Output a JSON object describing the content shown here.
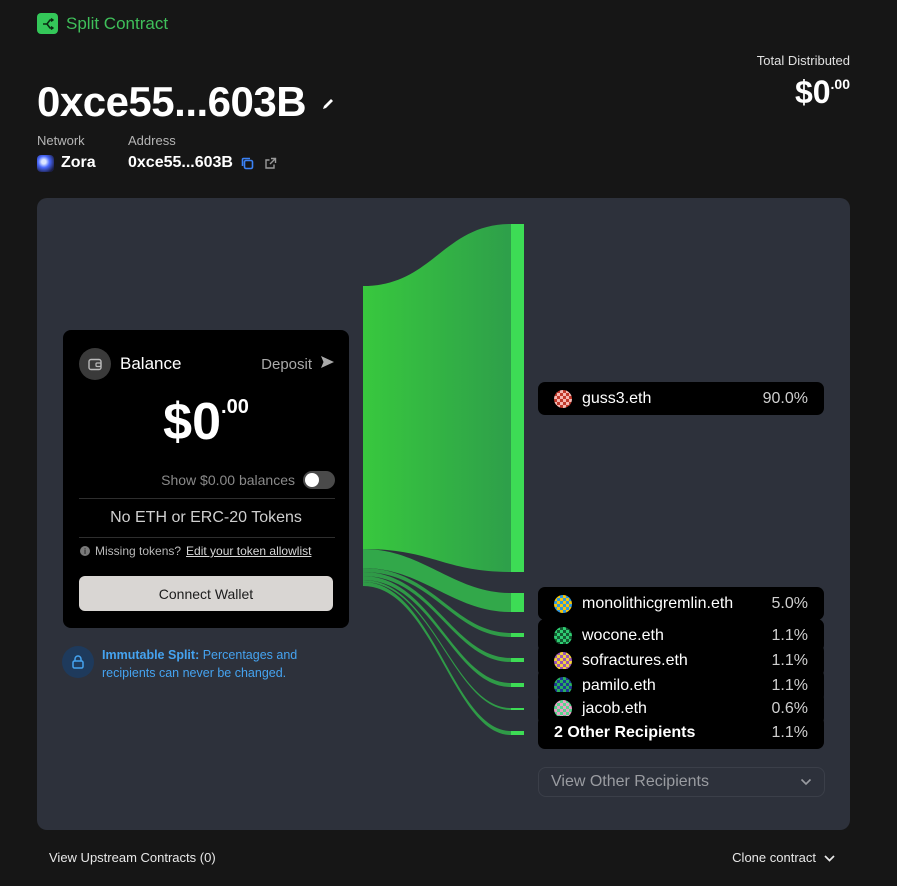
{
  "brand": {
    "label": "Split Contract",
    "accent": "#34c759"
  },
  "header": {
    "title": "0xce55...603B",
    "network_label": "Network",
    "network_value": "Zora",
    "address_label": "Address",
    "address_value": "0xce55...603B"
  },
  "total": {
    "label": "Total Distributed",
    "amount": "$0",
    "cents": ".00"
  },
  "balance": {
    "title": "Balance",
    "deposit_label": "Deposit",
    "amount": "$0",
    "cents": ".00",
    "show_zero_label": "Show $0.00 balances",
    "show_zero_enabled": false,
    "empty_text": "No ETH or ERC-20 Tokens",
    "missing_text": "Missing tokens?",
    "allowlist_link": "Edit your token allowlist",
    "connect_label": "Connect Wallet"
  },
  "immutable": {
    "bold": "Immutable Split:",
    "text": "Percentages and recipients can never be changed."
  },
  "recipients": [
    {
      "name": "guss3.eth",
      "pct": "90.0%",
      "share": 90.0,
      "avatar": "#c0392b"
    },
    {
      "name": "monolithicgremlin.eth",
      "pct": "5.0%",
      "share": 5.0,
      "avatar": "#f1c40f"
    },
    {
      "name": "wocone.eth",
      "pct": "1.1%",
      "share": 1.1,
      "avatar": "#2ecc71"
    },
    {
      "name": "sofractures.eth",
      "pct": "1.1%",
      "share": 1.1,
      "avatar": "#9b59b6"
    },
    {
      "name": "pamilo.eth",
      "pct": "1.1%",
      "share": 1.1,
      "avatar": "#27ae60"
    },
    {
      "name": "jacob.eth",
      "pct": "0.6%",
      "share": 0.6,
      "avatar": "#e8a0c8"
    },
    {
      "name": "2 Other Recipients",
      "pct": "1.1%",
      "share": 1.1,
      "avatar": ""
    }
  ],
  "view_other_label": "View Other Recipients",
  "footer": {
    "upstream_label": "View Upstream Contracts (0)",
    "clone_label": "Clone contract"
  }
}
